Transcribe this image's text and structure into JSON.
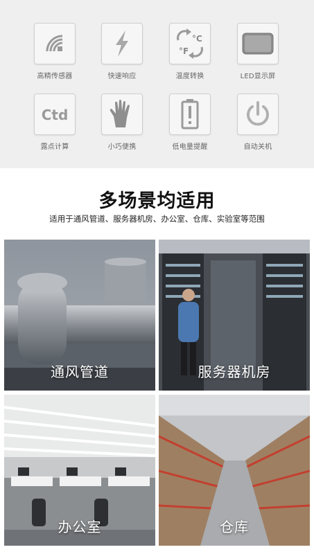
{
  "features": [
    {
      "icon": "wireless-sensor-icon",
      "label": "高精传感器"
    },
    {
      "icon": "lightning-icon",
      "label": "快速响应"
    },
    {
      "icon": "temperature-switch-icon",
      "label": "温度转换",
      "glyph_c": "°C",
      "glyph_f": "°F"
    },
    {
      "icon": "led-screen-icon",
      "label": "LED显示屏"
    },
    {
      "icon": "ctd-icon",
      "label": "露点计算",
      "glyph": "Ctd"
    },
    {
      "icon": "hand-icon",
      "label": "小巧便携"
    },
    {
      "icon": "low-battery-icon",
      "label": "低电量提醒"
    },
    {
      "icon": "power-icon",
      "label": "自动关机"
    }
  ],
  "section": {
    "title": "多场景均适用",
    "subtitle": "适用于通风管道、服务器机房、办公室、仓库、实验室等范围"
  },
  "scenes": [
    {
      "name": "duct",
      "label": "通风管道"
    },
    {
      "name": "server-room",
      "label": "服务器机房"
    },
    {
      "name": "office",
      "label": "办公室"
    },
    {
      "name": "warehouse",
      "label": "仓库"
    }
  ],
  "colors": {
    "panel_bg": "#efefef",
    "icon_gray": "#9a9a9a",
    "caption": "#ffffff"
  }
}
